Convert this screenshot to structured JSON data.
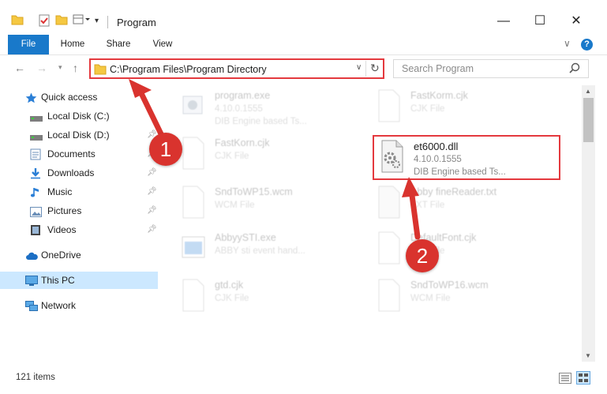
{
  "window": {
    "title": "Program",
    "minimize_glyph": "—",
    "maximize_glyph": "☐",
    "close_glyph": "✕"
  },
  "ribbon": {
    "tabs": [
      "File",
      "Home",
      "Share",
      "View"
    ],
    "help_glyph": "?",
    "expand_glyph": "∨"
  },
  "address": {
    "path": "C:\\Program Files\\Program Directory",
    "search_placeholder": "Search Program"
  },
  "nav": {
    "quick_access": "Quick access",
    "items": [
      {
        "label": "Local Disk (C:)",
        "icon": "drive-icon"
      },
      {
        "label": "Local Disk (D:)",
        "icon": "drive-icon"
      },
      {
        "label": "Documents",
        "icon": "documents-icon"
      },
      {
        "label": "Downloads",
        "icon": "downloads-icon"
      },
      {
        "label": "Music",
        "icon": "music-icon"
      },
      {
        "label": "Pictures",
        "icon": "pictures-icon"
      },
      {
        "label": "Videos",
        "icon": "videos-icon"
      }
    ],
    "onedrive": "OneDrive",
    "this_pc": "This PC",
    "network": "Network"
  },
  "files": [
    {
      "name": "program.exe",
      "line1": "4.10.0.1555",
      "line2": "DIB Engine based Ts..."
    },
    {
      "name": "FastKorm.cjk",
      "line1": "CJK File",
      "line2": ""
    },
    {
      "name": "FastKorn.cjk",
      "line1": "CJK File",
      "line2": ""
    },
    {
      "name": "et6000.dll",
      "line1": "4.10.0.1555",
      "line2": "DIB Engine based Ts..."
    },
    {
      "name": "SndToWP15.wcm",
      "line1": "WCM File",
      "line2": ""
    },
    {
      "name": "Abby fineReader.txt",
      "line1": "TXT File",
      "line2": ""
    },
    {
      "name": "AbbyySTI.exe",
      "line1": "ABBY sti event hand...",
      "line2": ""
    },
    {
      "name": "DefaultFont.cjk",
      "line1": "CJK File",
      "line2": ""
    },
    {
      "name": "gtd.cjk",
      "line1": "CJK File",
      "line2": ""
    },
    {
      "name": "SndToWP16.wcm",
      "line1": "WCM File",
      "line2": ""
    }
  ],
  "status": {
    "item_count": "121 items"
  },
  "annotations": {
    "marker1": "1",
    "marker2": "2",
    "color": "#d9332e"
  }
}
